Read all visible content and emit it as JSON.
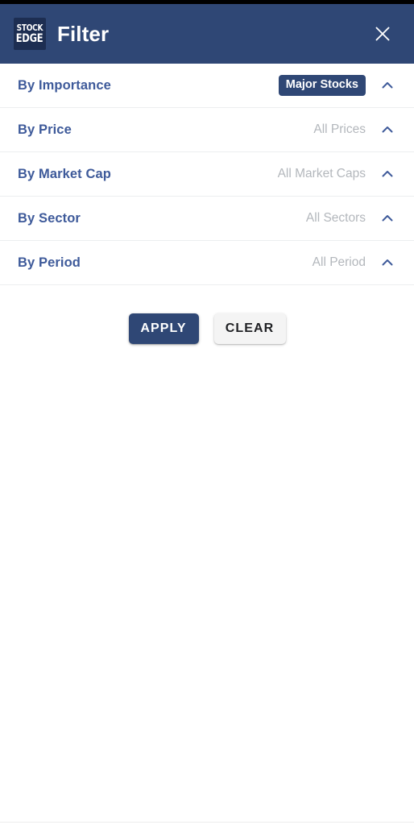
{
  "header": {
    "logo_line1": "STOCK",
    "logo_line2": "EDGE",
    "logo_name": "stockedge-logo",
    "title": "Filter",
    "close_icon": "close-icon",
    "background_color": "#2f4775"
  },
  "filters": [
    {
      "label": "By Importance",
      "value": "Major Stocks",
      "value_style": "badge",
      "chevron_icon": "chevron-up-icon",
      "name": "by-importance"
    },
    {
      "label": "By Price",
      "value": "All Prices",
      "value_style": "muted",
      "chevron_icon": "chevron-up-icon",
      "name": "by-price"
    },
    {
      "label": "By Market Cap",
      "value": "All Market Caps",
      "value_style": "muted",
      "chevron_icon": "chevron-up-icon",
      "name": "by-market-cap"
    },
    {
      "label": "By Sector",
      "value": "All Sectors",
      "value_style": "muted",
      "chevron_icon": "chevron-up-icon",
      "name": "by-sector"
    },
    {
      "label": "By Period",
      "value": "All Period",
      "value_style": "muted",
      "chevron_icon": "chevron-up-icon",
      "name": "by-period"
    }
  ],
  "actions": {
    "apply_label": "APPLY",
    "clear_label": "CLEAR"
  },
  "colors": {
    "accent_navy": "#2f4775",
    "label_blue": "#3e5a9a",
    "muted_gray": "#b3b7bc",
    "divider": "#eceef0",
    "badge_bg": "#2f4775"
  }
}
